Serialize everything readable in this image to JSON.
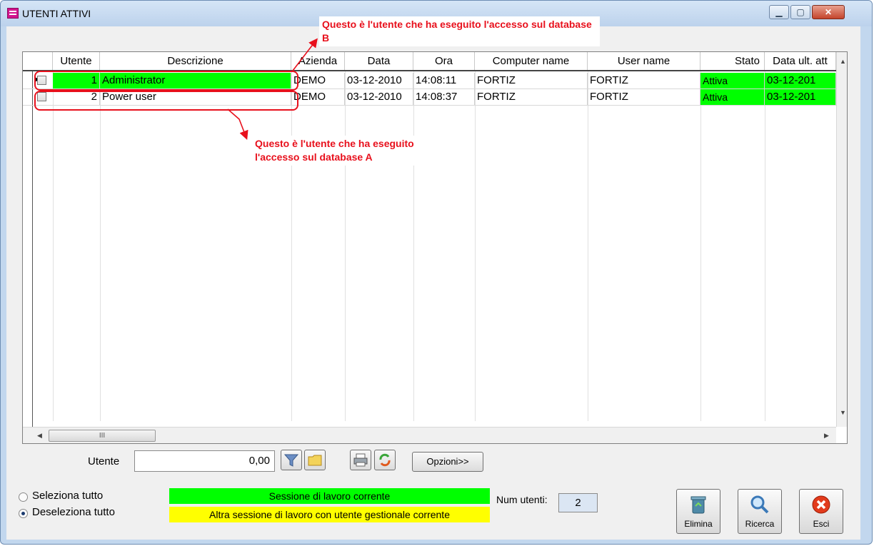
{
  "window": {
    "title": "UTENTI ATTIVI",
    "minimize_glyph": "▁",
    "maximize_glyph": "▢",
    "close_glyph": "✕"
  },
  "grid": {
    "columns": [
      "Utente",
      "Descrizione",
      "Azienda",
      "Data",
      "Ora",
      "Computer name",
      "User name",
      "Stato",
      "Data ult. att"
    ],
    "rows": [
      {
        "utente": "1",
        "descrizione": "Administrator",
        "azienda": "DEMO",
        "data": "03-12-2010",
        "ora": "14:08:11",
        "computer": "FORTIZ",
        "user": "FORTIZ",
        "stato": "Attiva",
        "data_ult": "03-12-201"
      },
      {
        "utente": "2",
        "descrizione": "Power user",
        "azienda": "DEMO",
        "data": "03-12-2010",
        "ora": "14:08:37",
        "computer": "FORTIZ",
        "user": "FORTIZ",
        "stato": "Attiva",
        "data_ult": "03-12-201"
      }
    ],
    "hscroll_thumb": "III"
  },
  "annotations": {
    "top": "Questo è l'utente che ha eseguito l'accesso sul database B",
    "bottom": "Questo è l'utente che ha eseguito l'accesso sul database A"
  },
  "filter": {
    "label": "Utente",
    "value": "0,00",
    "options_label": "Opzioni>>"
  },
  "selection": {
    "select_all": "Seleziona tutto",
    "deselect_all": "Deseleziona tutto",
    "selected": "deselect_all"
  },
  "legend": {
    "current": "Sessione di lavoro corrente",
    "other": "Altra sessione di lavoro con utente gestionale corrente",
    "current_color": "#00ff00",
    "other_color": "#ffff00"
  },
  "count": {
    "label": "Num utenti:",
    "value": "2"
  },
  "actions": {
    "delete": "Elimina",
    "search": "Ricerca",
    "exit": "Esci"
  },
  "colors": {
    "annotation_red": "#e8101c",
    "window_frame": "#c2d7ee"
  }
}
